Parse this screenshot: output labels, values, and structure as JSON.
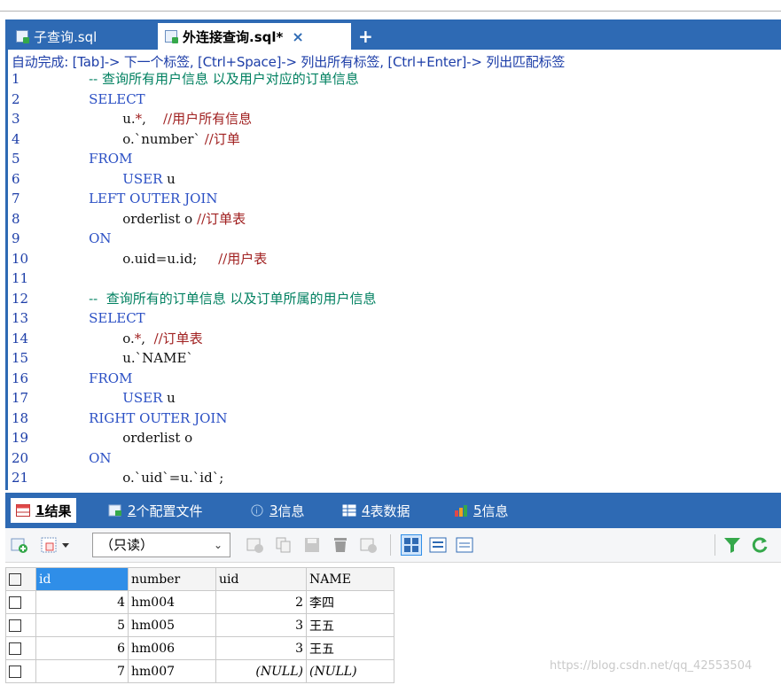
{
  "editor_tabs": [
    {
      "label": "子查询.sql",
      "active": false
    },
    {
      "label": "外连接查询.sql*",
      "active": true
    }
  ],
  "tab_close": "×",
  "tab_add": "+",
  "autocomplete_hint": "自动完成: [Tab]-> 下一个标签, [Ctrl+Space]-> 列出所有标签, [Ctrl+Enter]-> 列出匹配标签",
  "code_lines": [
    {
      "n": "1",
      "parts": [
        {
          "t": "    -- 查询所有用户信息 以及用户对应的订单信息",
          "c": "cmt"
        }
      ]
    },
    {
      "n": "2",
      "parts": [
        {
          "t": "    SELECT",
          "c": "kw"
        }
      ]
    },
    {
      "n": "3",
      "parts": [
        {
          "t": "            u.",
          "c": "plain"
        },
        {
          "t": "*",
          "c": "red"
        },
        {
          "t": ",    ",
          "c": "plain"
        },
        {
          "t": "//用户所有信息",
          "c": "red"
        }
      ]
    },
    {
      "n": "4",
      "parts": [
        {
          "t": "            o.`number` ",
          "c": "plain"
        },
        {
          "t": "//订单",
          "c": "red"
        }
      ]
    },
    {
      "n": "5",
      "parts": [
        {
          "t": "    FROM",
          "c": "kw"
        }
      ]
    },
    {
      "n": "6",
      "parts": [
        {
          "t": "            USER",
          "c": "kw"
        },
        {
          "t": " u",
          "c": "plain"
        }
      ]
    },
    {
      "n": "7",
      "parts": [
        {
          "t": "    LEFT OUTER JOIN",
          "c": "kw"
        }
      ]
    },
    {
      "n": "8",
      "parts": [
        {
          "t": "            orderlist o ",
          "c": "plain"
        },
        {
          "t": "//订单表",
          "c": "red"
        }
      ]
    },
    {
      "n": "9",
      "parts": [
        {
          "t": "    ON",
          "c": "kw"
        }
      ]
    },
    {
      "n": "10",
      "parts": [
        {
          "t": "            o.uid=u.id;     ",
          "c": "plain"
        },
        {
          "t": "//用户表",
          "c": "red"
        }
      ]
    },
    {
      "n": "11",
      "parts": [
        {
          "t": "",
          "c": "plain"
        }
      ]
    },
    {
      "n": "12",
      "parts": [
        {
          "t": "    --  查询所有的订单信息 以及订单所属的用户信息",
          "c": "cmt"
        }
      ]
    },
    {
      "n": "13",
      "parts": [
        {
          "t": "    SELECT",
          "c": "kw"
        }
      ]
    },
    {
      "n": "14",
      "parts": [
        {
          "t": "            o.",
          "c": "plain"
        },
        {
          "t": "*",
          "c": "red"
        },
        {
          "t": ",  ",
          "c": "plain"
        },
        {
          "t": "//订单表",
          "c": "red"
        }
      ]
    },
    {
      "n": "15",
      "parts": [
        {
          "t": "            u.`NAME`",
          "c": "plain"
        }
      ]
    },
    {
      "n": "16",
      "parts": [
        {
          "t": "    FROM",
          "c": "kw"
        }
      ]
    },
    {
      "n": "17",
      "parts": [
        {
          "t": "            USER",
          "c": "kw"
        },
        {
          "t": " u",
          "c": "plain"
        }
      ]
    },
    {
      "n": "18",
      "parts": [
        {
          "t": "    RIGHT OUTER JOIN",
          "c": "kw"
        }
      ]
    },
    {
      "n": "19",
      "parts": [
        {
          "t": "            orderlist o",
          "c": "plain"
        }
      ]
    },
    {
      "n": "20",
      "parts": [
        {
          "t": "    ON",
          "c": "kw"
        }
      ]
    },
    {
      "n": "21",
      "parts": [
        {
          "t": "            o.`uid`=u.`id`;",
          "c": "plain"
        }
      ]
    }
  ],
  "result_tabs": [
    {
      "num": "1",
      "label": " 结果",
      "icon": "result-grid-icon"
    },
    {
      "num": "2",
      "label": " 个配置文件",
      "icon": "profile-icon"
    },
    {
      "num": "3",
      "label": " 信息",
      "icon": "info-icon"
    },
    {
      "num": "4",
      "label": " 表数据",
      "icon": "table-data-icon"
    },
    {
      "num": "5",
      "label": " 信息",
      "icon": "info-chart-icon"
    }
  ],
  "toolbar": {
    "readonly_select": "（只读）"
  },
  "grid": {
    "columns": [
      "id",
      "number",
      "uid",
      "NAME"
    ],
    "rows": [
      [
        "4",
        "hm004",
        "2",
        "李四"
      ],
      [
        "5",
        "hm005",
        "3",
        "王五"
      ],
      [
        "6",
        "hm006",
        "3",
        "王五"
      ],
      [
        "7",
        "hm007",
        "(NULL)",
        "(NULL)"
      ]
    ]
  },
  "watermark": "https://blog.csdn.net/qq_42553504",
  "colors": {
    "accent": "#2e6ab4",
    "keyword": "#2a4fc4",
    "comment": "#008060",
    "line_comment": "#a02020",
    "selected_header": "#2f8ee8"
  }
}
